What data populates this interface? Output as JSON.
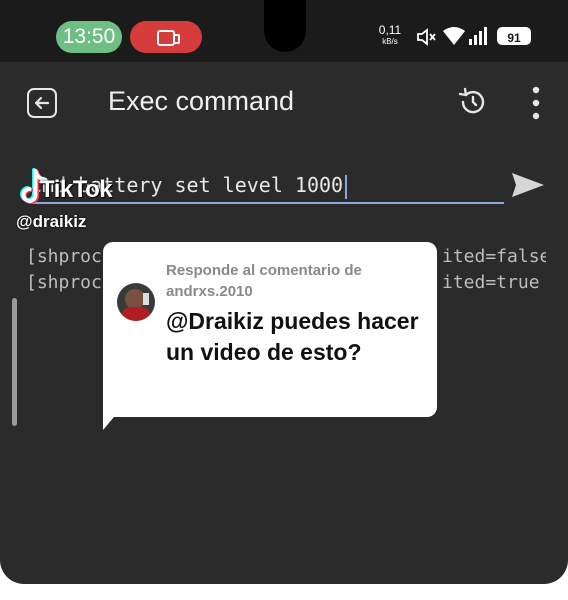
{
  "status_bar": {
    "time": "13:50",
    "network_speed_value": "0,11",
    "network_speed_unit": "kB/s",
    "battery": "91",
    "icons": [
      "screen-record-icon",
      "mute-icon",
      "wifi-icon",
      "signal-icon",
      "battery-icon"
    ]
  },
  "app_bar": {
    "title": "Exec command",
    "icons": [
      "back-icon",
      "history-icon",
      "more-vert-icon"
    ]
  },
  "command": {
    "value": "cmd battery set level 1000",
    "send_icon": "send-icon"
  },
  "overlay": {
    "brand": "TikTok",
    "handle": "@draikiz"
  },
  "output": {
    "lines": [
      {
        "left": "[shproc",
        "right": "ited=false"
      },
      {
        "left": "[shproc",
        "right": "ited=true"
      }
    ]
  },
  "reply_bubble": {
    "label": "Responde al comentario de andrxs.2010",
    "comment": "@Draikiz puedes hacer un video de esto?"
  },
  "colors": {
    "background": "#2b2b2b",
    "status_bar": "#1b1b1b",
    "time_pill": "#6fbf84",
    "record_pill": "#d63c3c",
    "input_underline": "#8ea7d8"
  }
}
